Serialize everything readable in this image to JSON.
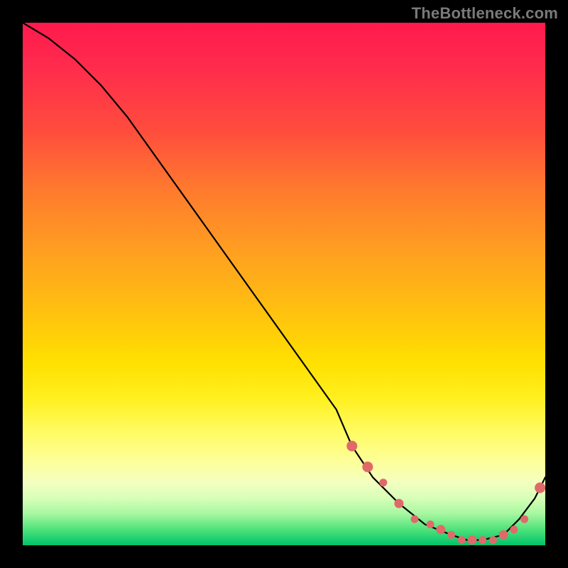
{
  "watermark": "TheBottleneck.com",
  "chart_data": {
    "type": "line",
    "title": "",
    "xlabel": "",
    "ylabel": "",
    "xlim": [
      0,
      100
    ],
    "ylim": [
      0,
      100
    ],
    "series": [
      {
        "name": "curve",
        "x": [
          0,
          5,
          10,
          15,
          20,
          25,
          30,
          35,
          40,
          45,
          50,
          55,
          60,
          63,
          67,
          72,
          77,
          82,
          85,
          88,
          92,
          95,
          98,
          100
        ],
        "y": [
          100,
          97,
          93,
          88,
          82,
          75,
          68,
          61,
          54,
          47,
          40,
          33,
          26,
          19,
          13,
          8,
          4,
          2,
          1,
          1,
          2,
          5,
          9,
          13
        ]
      }
    ],
    "markers": {
      "name": "highlight",
      "x": [
        63,
        66,
        69,
        72,
        75,
        78,
        80,
        82,
        84,
        86,
        88,
        90,
        92,
        94,
        96,
        99
      ],
      "y": [
        19,
        15,
        12,
        8,
        5,
        4,
        3,
        2,
        1,
        1,
        1,
        1,
        2,
        3,
        5,
        11
      ]
    },
    "gradient_bands": [
      "#ff1a4d",
      "#ff4a3e",
      "#ffa020",
      "#ffe000",
      "#fdff9a",
      "#a6f7a0",
      "#00c46a"
    ]
  }
}
